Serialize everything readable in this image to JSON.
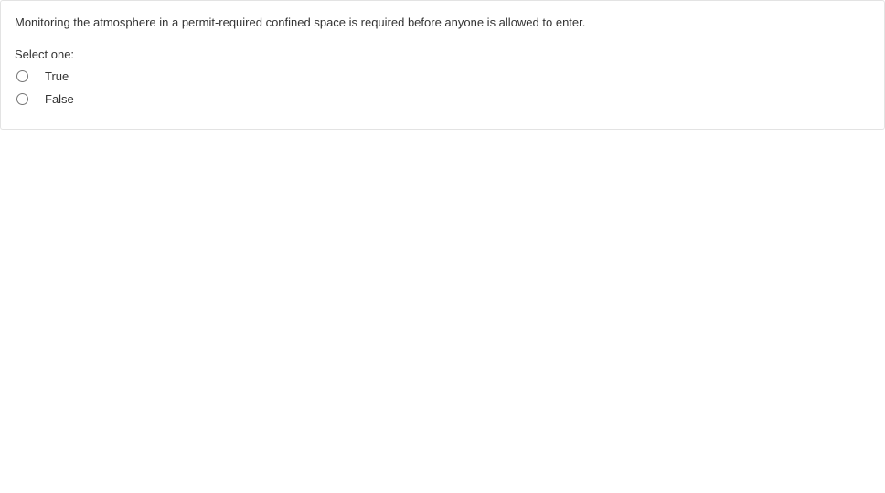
{
  "question": {
    "text": "Monitoring the atmosphere in a permit-required confined space is required before anyone is allowed to enter.",
    "prompt": "Select one:",
    "options": [
      {
        "label": "True"
      },
      {
        "label": "False"
      }
    ]
  }
}
